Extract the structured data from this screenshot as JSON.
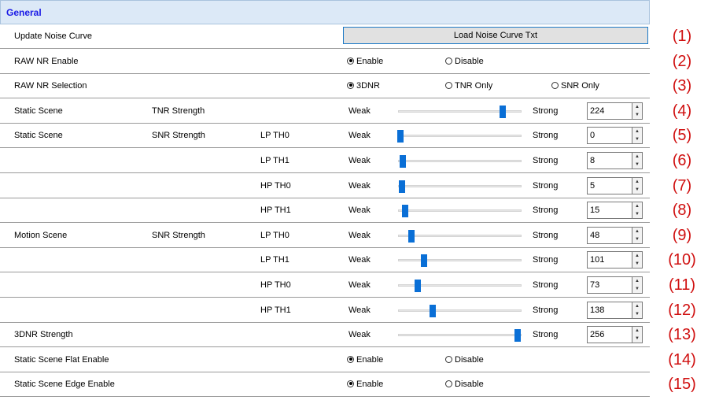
{
  "section_title": "General",
  "labels": {
    "weak": "Weak",
    "strong": "Strong"
  },
  "rows": [
    {
      "c1": "Update Noise Curve",
      "button": "Load Noise Curve Txt",
      "num": "(1)"
    },
    {
      "c1": "RAW NR Enable",
      "radios": [
        {
          "label": "Enable",
          "checked": true
        },
        {
          "label": "Disable",
          "checked": false
        }
      ],
      "num": "(2)"
    },
    {
      "c1": "RAW NR Selection",
      "radios": [
        {
          "label": "3DNR",
          "checked": true
        },
        {
          "label": "TNR Only",
          "checked": false
        },
        {
          "label": "SNR Only",
          "checked": false
        }
      ],
      "num": "(3)"
    },
    {
      "c1": "Static Scene",
      "c2": "TNR Strength",
      "value": "224",
      "slider": 0.85,
      "num": "(4)"
    },
    {
      "c1": "Static Scene",
      "c2": "SNR Strength",
      "c3": "LP TH0",
      "value": "0",
      "slider": 0.02,
      "num": "(5)"
    },
    {
      "c3": "LP TH1",
      "value": "8",
      "slider": 0.04,
      "num": "(6)"
    },
    {
      "c3": "HP TH0",
      "value": "5",
      "slider": 0.035,
      "num": "(7)"
    },
    {
      "c3": "HP TH1",
      "value": "15",
      "slider": 0.055,
      "num": "(8)"
    },
    {
      "c1": "Motion Scene",
      "c2": "SNR Strength",
      "c3": "LP TH0",
      "value": "48",
      "slider": 0.11,
      "num": "(9)"
    },
    {
      "c3": "LP TH1",
      "value": "101",
      "slider": 0.21,
      "num": "(10)"
    },
    {
      "c3": "HP TH0",
      "value": "73",
      "slider": 0.16,
      "num": "(11)"
    },
    {
      "c3": "HP TH1",
      "value": "138",
      "slider": 0.28,
      "num": "(12)"
    },
    {
      "c1": "3DNR Strength",
      "value": "256",
      "slider": 0.97,
      "num": "(13)"
    },
    {
      "c1": "Static Scene Flat Enable",
      "radios": [
        {
          "label": "Enable",
          "checked": true
        },
        {
          "label": "Disable",
          "checked": false
        }
      ],
      "num": "(14)"
    },
    {
      "c1": "Static Scene Edge Enable",
      "radios": [
        {
          "label": "Enable",
          "checked": true
        },
        {
          "label": "Disable",
          "checked": false
        }
      ],
      "num": "(15)"
    }
  ]
}
